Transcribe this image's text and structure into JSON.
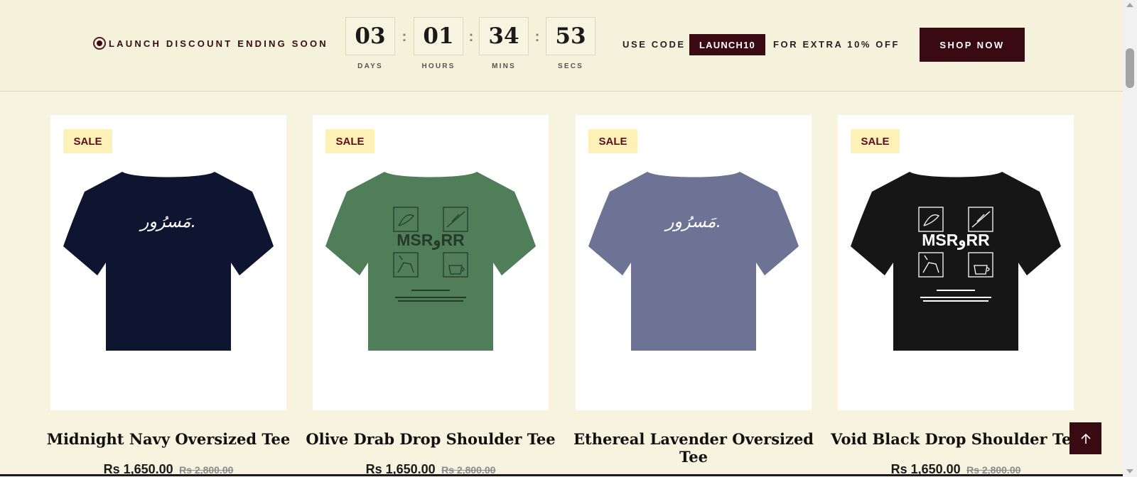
{
  "announcement": {
    "label": "LAUNCH DISCOUNT ENDING SOON",
    "countdown": [
      {
        "value": "03",
        "unit": "DAYS"
      },
      {
        "value": "01",
        "unit": "HOURS"
      },
      {
        "value": "34",
        "unit": "MINS"
      },
      {
        "value": "53",
        "unit": "SECS"
      }
    ],
    "separator": ":",
    "use_code_label": "USE CODE",
    "code": "LAUNCH10",
    "extra_label": "FOR EXTRA 10% OFF",
    "shop_button": "SHOP NOW"
  },
  "products": [
    {
      "badge": "SALE",
      "title_line1": "Midnight Navy Oversized Tee",
      "title_line2": "",
      "price": "Rs 1,650.00",
      "compare_price": "Rs 2,800.00",
      "shirt_color": "#0e1530",
      "design": "calligraphy",
      "print_text": "مَسرُور."
    },
    {
      "badge": "SALE",
      "title_line1": "Olive Drab Drop Shoulder Tee",
      "title_line2": "",
      "price": "Rs 1,650.00",
      "compare_price": "Rs 2,800.00",
      "shirt_color": "#4f7e59",
      "design": "grid",
      "print_text": "MSRوRR"
    },
    {
      "badge": "SALE",
      "title_line1": "Ethereal Lavender Oversized",
      "title_line2": "Tee",
      "price": "",
      "compare_price": "",
      "shirt_color": "#6d7394",
      "design": "calligraphy",
      "print_text": "مَسرُور."
    },
    {
      "badge": "SALE",
      "title_line1": "Void Black Drop Shoulder Tee",
      "title_line2": "",
      "price": "Rs 1,650.00",
      "compare_price": "Rs 2,800.00",
      "shirt_color": "#161616",
      "design": "grid",
      "print_text": "MSRوRR"
    }
  ],
  "colors": {
    "background": "#f6f3de",
    "brand": "#3a0a12",
    "sale_badge": "#fdf1b8"
  },
  "icons": {
    "back_to_top": "arrow-up-icon",
    "status": "radio-dot-icon"
  }
}
